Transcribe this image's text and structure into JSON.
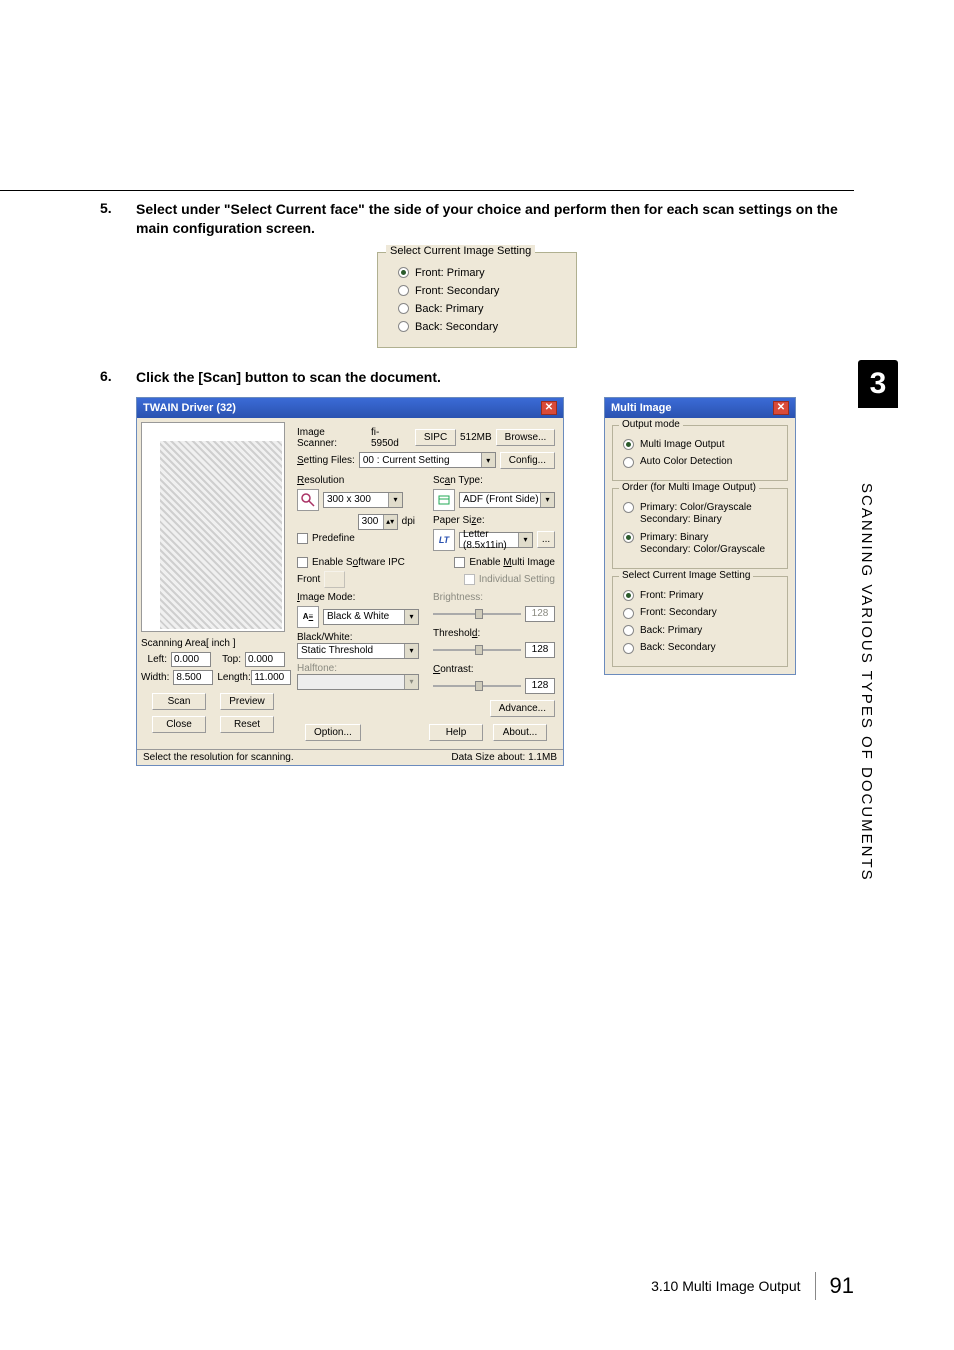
{
  "steps": {
    "s5_num": "5.",
    "s5_text": "Select under \"Select Current face\" the side of your choice and perform then for each scan settings on the main configuration screen.",
    "s6_num": "6.",
    "s6_text": "Click the [Scan] button to scan the document."
  },
  "select_group": {
    "legend": "Select Current Image Setting",
    "opts": [
      "Front: Primary",
      "Front: Secondary",
      "Back: Primary",
      "Back: Secondary"
    ],
    "checked_index": 0
  },
  "twain": {
    "title": "TWAIN Driver (32)",
    "top_row": {
      "scanner_lbl": "Image Scanner:",
      "scanner": "fi-5950d",
      "sipc": "SIPC",
      "mem": "512MB",
      "browse": "Browse..."
    },
    "setting_files": {
      "lbl": "Setting Files:",
      "value": "00 : Current Setting",
      "config": "Config..."
    },
    "resolution": {
      "lbl": "Resolution",
      "value": "300 x 300",
      "dpi_lbl": "dpi",
      "dpi_val": "300",
      "predefine": "Predefine"
    },
    "scan_type": {
      "lbl": "Scan Type:",
      "value": "ADF (Front Side)"
    },
    "paper_size": {
      "lbl": "Paper Size:",
      "value": "Letter (8.5x11in)",
      "more": "..."
    },
    "enable_ipc": "Enable Software IPC",
    "enable_multi": "Enable Multi Image",
    "front": "Front",
    "individual": "Individual Setting",
    "image_mode": {
      "lbl": "Image Mode:",
      "value": "Black & White"
    },
    "bw": {
      "lbl": "Black/White:",
      "value": "Static Threshold"
    },
    "halftone_lbl": "Halftone:",
    "brightness": {
      "lbl": "Brightness:",
      "val": "128"
    },
    "threshold": {
      "lbl": "Threshold:",
      "val": "128"
    },
    "contrast": {
      "lbl": "Contrast:",
      "val": "128"
    },
    "advance": "Advance...",
    "scan_area_lbl": "Scanning Area[ inch ]",
    "left_lbl": "Left:",
    "left_v": "0.000",
    "top_lbl": "Top:",
    "top_v": "0.000",
    "width_lbl": "Width:",
    "width_v": "8.500",
    "length_lbl": "Length:",
    "length_v": "11.000",
    "scan_btn": "Scan",
    "preview_btn": "Preview",
    "close_btn": "Close",
    "reset_btn": "Reset",
    "option_btn": "Option...",
    "help_btn": "Help",
    "about_btn": "About...",
    "status_left": "Select the resolution for scanning.",
    "status_right_lbl": "Data Size about:",
    "status_right_v": "1.1MB"
  },
  "multi": {
    "title": "Multi Image",
    "g1": {
      "legend": "Output mode",
      "opts": [
        "Multi Image Output",
        "Auto Color Detection"
      ],
      "checked_index": 0
    },
    "g2": {
      "legend": "Order (for Multi Image Output)",
      "opts": [
        "Primary: Color/Grayscale\nSecondary: Binary",
        "Primary: Binary\nSecondary: Color/Grayscale"
      ],
      "checked_index": 1
    },
    "g3": {
      "legend": "Select Current Image Setting",
      "opts": [
        "Front: Primary",
        "Front: Secondary",
        "Back: Primary",
        "Back: Secondary"
      ],
      "checked_index": 0
    }
  },
  "sidebar": {
    "chapter": "3",
    "title": "SCANNING VARIOUS TYPES OF DOCUMENTS"
  },
  "footer": {
    "section": "3.10 Multi Image Output",
    "page": "91"
  }
}
